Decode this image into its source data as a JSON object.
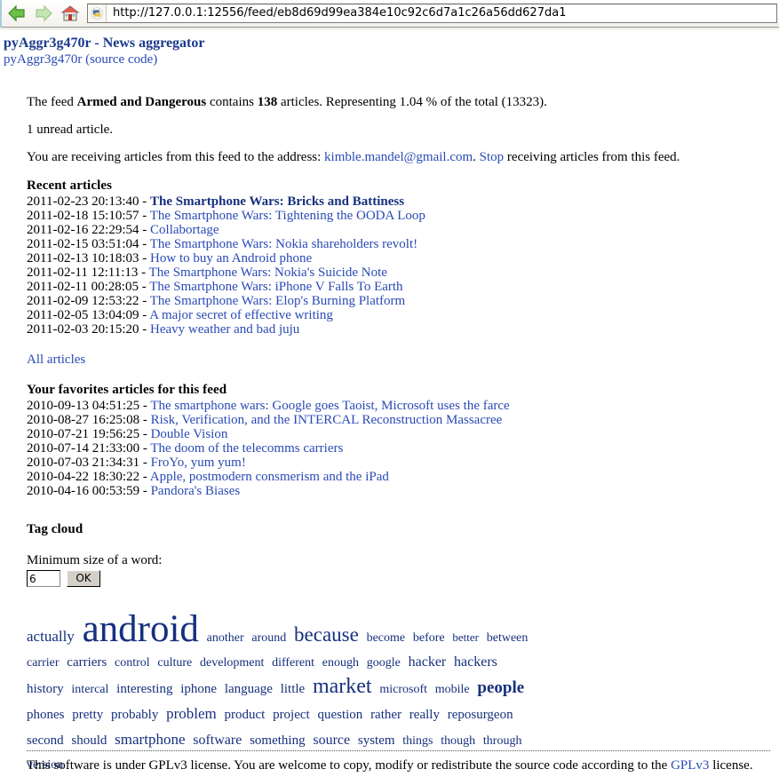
{
  "browser": {
    "back_icon": "back-arrow-icon",
    "forward_icon": "forward-arrow-icon",
    "home_icon": "home-icon",
    "favicon": "python-favicon",
    "url": "http://127.0.0.1:12556/feed/eb8d69d99ea384e10c92c6d7a1c26a56dd627da1"
  },
  "header": {
    "title": "pyAggr3g470r - News aggregator",
    "source_code_link": "pyAggr3g470r (source code)",
    "title_color": "#1b3a8c",
    "link_color": "#2a4ab5"
  },
  "summary": {
    "line1_prefix": "The feed ",
    "feed_name": "Armed and Dangerous",
    "line1_mid": " contains ",
    "article_count": "138",
    "line1_suffix": " articles. Representing 1.04 % of the total (13323).",
    "unread_line": "1 unread article.",
    "receiving_prefix": "You are receiving articles from this feed to the address: ",
    "email": "kimble.mandel@gmail.com",
    "receiving_mid": ". ",
    "stop_label": "Stop",
    "receiving_suffix": " receiving articles from this feed."
  },
  "recent": {
    "heading": "Recent articles",
    "items": [
      {
        "stamp": "2011-02-23 20:13:40",
        "title": "The Smartphone Wars: Bricks and Battiness",
        "unread": true
      },
      {
        "stamp": "2011-02-18 15:10:57",
        "title": "The Smartphone Wars: Tightening the OODA Loop",
        "unread": false
      },
      {
        "stamp": "2011-02-16 22:29:54",
        "title": "Collabortage",
        "unread": false
      },
      {
        "stamp": "2011-02-15 03:51:04",
        "title": "The Smartphone Wars: Nokia shareholders revolt!",
        "unread": false
      },
      {
        "stamp": "2011-02-13 10:18:03",
        "title": "How to buy an Android phone",
        "unread": false
      },
      {
        "stamp": "2011-02-11 12:11:13",
        "title": "The Smartphone Wars: Nokia's Suicide Note",
        "unread": false
      },
      {
        "stamp": "2011-02-11 00:28:05",
        "title": "The Smartphone Wars: iPhone V Falls To Earth",
        "unread": false
      },
      {
        "stamp": "2011-02-09 12:53:22",
        "title": "The Smartphone Wars: Elop's Burning Platform",
        "unread": false
      },
      {
        "stamp": "2011-02-05 13:04:09",
        "title": "A major secret of effective writing",
        "unread": false
      },
      {
        "stamp": "2011-02-03 20:15:20",
        "title": "Heavy weather and bad juju",
        "unread": false
      }
    ],
    "all_articles_label": "All articles"
  },
  "favorites": {
    "heading": "Your favorites articles for this feed",
    "items": [
      {
        "stamp": "2010-09-13 04:51:25",
        "title": "The smartphone wars: Google goes Taoist, Microsoft uses the farce"
      },
      {
        "stamp": "2010-08-27 16:25:08",
        "title": "Risk, Verification, and the INTERCAL Reconstruction Massacree"
      },
      {
        "stamp": "2010-07-21 19:56:25",
        "title": "Double Vision"
      },
      {
        "stamp": "2010-07-14 21:33:00",
        "title": "The doom of the telecomms carriers"
      },
      {
        "stamp": "2010-07-03 21:34:31",
        "title": "FroYo, yum yum!"
      },
      {
        "stamp": "2010-04-22 18:30:22",
        "title": "Apple, postmodern consmerism and the iPad"
      },
      {
        "stamp": "2010-04-16 00:53:59",
        "title": "Pandora's Biases"
      }
    ]
  },
  "tag_cloud": {
    "heading": "Tag cloud",
    "form_label": "Minimum size of a word:",
    "min_size_value": "6",
    "min_size_placeholder": "",
    "ok_label": "OK",
    "color": "#16307d",
    "tags": [
      {
        "word": "actually",
        "size": 17
      },
      {
        "word": "android",
        "size": 43
      },
      {
        "word": "another",
        "size": 14
      },
      {
        "word": "around",
        "size": 14
      },
      {
        "word": "because",
        "size": 23
      },
      {
        "word": "become",
        "size": 14
      },
      {
        "word": "before",
        "size": 14
      },
      {
        "word": "better",
        "size": 13
      },
      {
        "word": "between",
        "size": 14
      },
      {
        "word": "carrier",
        "size": 14
      },
      {
        "word": "carriers",
        "size": 15
      },
      {
        "word": "control",
        "size": 14
      },
      {
        "word": "culture",
        "size": 14
      },
      {
        "word": "development",
        "size": 14
      },
      {
        "word": "different",
        "size": 14
      },
      {
        "word": "enough",
        "size": 14
      },
      {
        "word": "google",
        "size": 14
      },
      {
        "word": "hacker",
        "size": 16
      },
      {
        "word": "hackers",
        "size": 16
      },
      {
        "word": "history",
        "size": 15
      },
      {
        "word": "intercal",
        "size": 14
      },
      {
        "word": "interesting",
        "size": 15
      },
      {
        "word": "iphone",
        "size": 15
      },
      {
        "word": "language",
        "size": 15
      },
      {
        "word": "little",
        "size": 15
      },
      {
        "word": "market",
        "size": 24
      },
      {
        "word": "microsoft",
        "size": 14
      },
      {
        "word": "mobile",
        "size": 14
      },
      {
        "word": "people",
        "size": 19
      },
      {
        "word": "phones",
        "size": 15
      },
      {
        "word": "pretty",
        "size": 15
      },
      {
        "word": "probably",
        "size": 15
      },
      {
        "word": "problem",
        "size": 17
      },
      {
        "word": "product",
        "size": 15
      },
      {
        "word": "project",
        "size": 15
      },
      {
        "word": "question",
        "size": 15
      },
      {
        "word": "rather",
        "size": 15
      },
      {
        "word": "really",
        "size": 15
      },
      {
        "word": "reposurgeon",
        "size": 15
      },
      {
        "word": "second",
        "size": 15
      },
      {
        "word": "should",
        "size": 15
      },
      {
        "word": "smartphone",
        "size": 17
      },
      {
        "word": "software",
        "size": 16
      },
      {
        "word": "something",
        "size": 15
      },
      {
        "word": "source",
        "size": 16
      },
      {
        "word": "system",
        "size": 15
      },
      {
        "word": "things",
        "size": 14
      },
      {
        "word": "though",
        "size": 14
      },
      {
        "word": "through",
        "size": 14
      },
      {
        "word": "version",
        "size": 14
      }
    ]
  },
  "footer": {
    "text_before": "This software is under GPLv3 license. You are welcome to copy, modify or redistribute the source code according to the ",
    "link_label": "GPLv3",
    "text_after": " license."
  }
}
